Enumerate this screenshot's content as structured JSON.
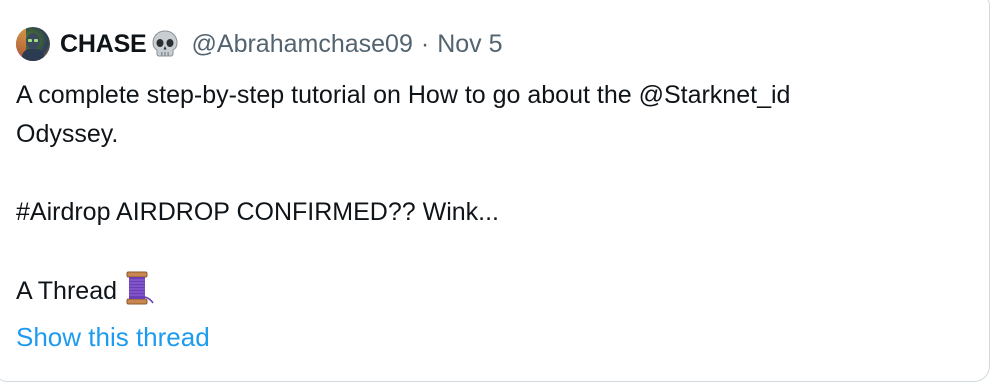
{
  "tweet": {
    "display_name": "CHASE",
    "name_emoji": "skull-icon",
    "handle": "@Abrahamchase09",
    "separator": "·",
    "date": "Nov 5",
    "lines": [
      "A complete step-by-step tutorial on How to go about the @Starknet_id",
      "Odyssey.",
      "",
      "#Airdrop AIRDROP CONFIRMED?? Wink...",
      "",
      "A Thread"
    ],
    "thread_emoji": "spool-of-thread-icon",
    "show_thread_label": "Show this thread"
  },
  "colors": {
    "text": "#0f1419",
    "muted": "#536471",
    "link": "#1d9bf0",
    "border": "#cfd9de"
  }
}
